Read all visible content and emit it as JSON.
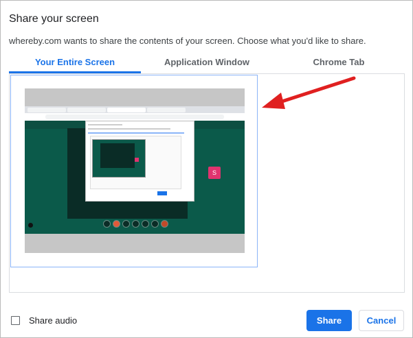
{
  "dialog": {
    "title": "Share your screen",
    "description": "whereby.com wants to share the contents of your screen. Choose what you'd like to share."
  },
  "tabs": [
    {
      "label": "Your Entire Screen",
      "active": true
    },
    {
      "label": "Application Window",
      "active": false
    },
    {
      "label": "Chrome Tab",
      "active": false
    }
  ],
  "thumbnail": {
    "participant_initial": "S"
  },
  "footer": {
    "share_audio_label": "Share audio",
    "share_audio_checked": false,
    "share_label": "Share",
    "cancel_label": "Cancel"
  },
  "colors": {
    "accent": "#1a73e8",
    "arrow": "#e02020",
    "whereby_green": "#0b5a4a",
    "participant_pink": "#e0336f"
  }
}
